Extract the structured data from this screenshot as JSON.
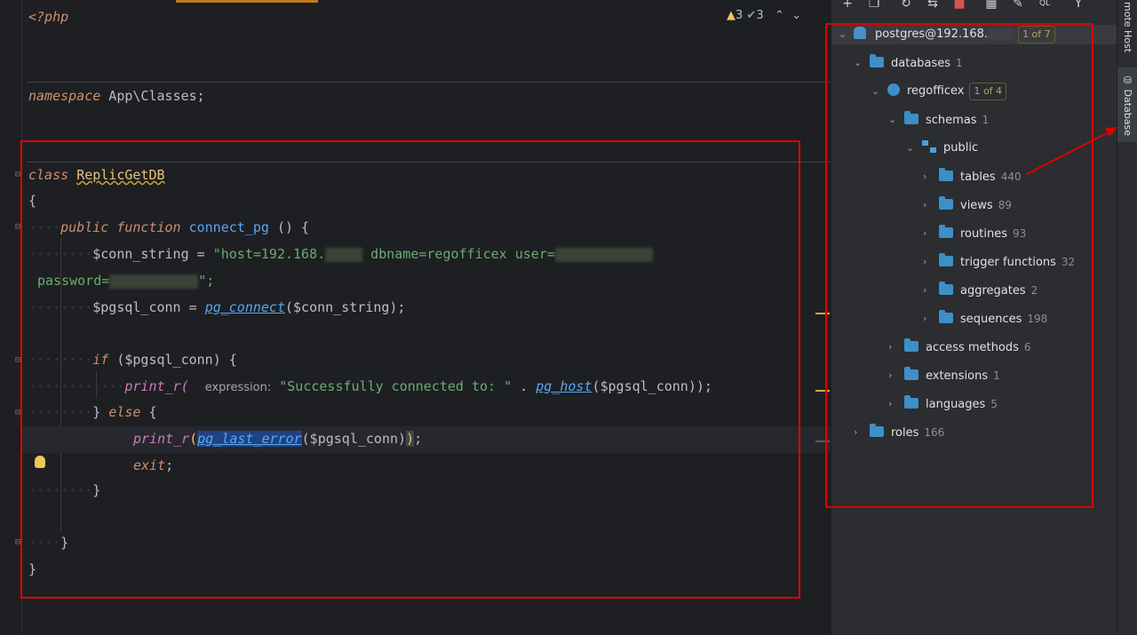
{
  "inspections": {
    "warnings": "3",
    "weak_warnings": "3"
  },
  "code": {
    "php_open": "<?php",
    "namespace_kw": "namespace",
    "namespace_name": " App\\Classes;",
    "class_kw": "class",
    "class_name": "ReplicGetDB",
    "brace_open": "{",
    "public_kw": "public",
    "function_kw": "function",
    "method_name": "connect_pg",
    "method_tail": " () {",
    "conn_var": "$conn_string",
    "assign": " = ",
    "str_part1": "\"host=192.168.",
    "str_part2": " dbname=regofficex user=",
    "str_part3": "password=",
    "str_end": "\";",
    "pgsql_var": "$pgsql_conn",
    "pg_connect": "pg_connect",
    "pg_connect_arg": "($conn_string);",
    "if_kw": "if",
    "if_cond": " ($pgsql_conn) {",
    "print_r": "print_r(",
    "hint_expression": "expression:",
    "success_str": "\"Successfully connected to: \"",
    "dot": " . ",
    "pg_host": "pg_host",
    "pg_host_arg": "($pgsql_conn));",
    "else_open": "} ",
    "else_kw": "else",
    "else_brace": " {",
    "print_r2": "print_r",
    "paren_open": "(",
    "pg_last_error": "pg_last_error",
    "last_err_arg": "($pgsql_conn)",
    "paren_close": ")",
    "semi": ";",
    "exit_kw": "exit",
    "exit_semi": ";",
    "brace_close": "}"
  },
  "toolbar": {
    "add_icon": "plus-icon",
    "refresh_icon": "refresh-icon",
    "stop_icon": "stop-icon",
    "edit_icon": "edit-icon",
    "filter_icon": "filter-icon"
  },
  "tree": {
    "connection": {
      "label": "postgres@192.168.",
      "badge": "1 of 7"
    },
    "databases": {
      "label": "databases",
      "count": "1"
    },
    "regofficex": {
      "label": "regofficex",
      "badge": "1 of 4"
    },
    "schemas": {
      "label": "schemas",
      "count": "1"
    },
    "public": {
      "label": "public"
    },
    "tables": {
      "label": "tables",
      "count": "440"
    },
    "views": {
      "label": "views",
      "count": "89"
    },
    "routines": {
      "label": "routines",
      "count": "93"
    },
    "trigger_functions": {
      "label": "trigger functions",
      "count": "32"
    },
    "aggregates": {
      "label": "aggregates",
      "count": "2"
    },
    "sequences": {
      "label": "sequences",
      "count": "198"
    },
    "access_methods": {
      "label": "access methods",
      "count": "6"
    },
    "extensions": {
      "label": "extensions",
      "count": "1"
    },
    "languages": {
      "label": "languages",
      "count": "5"
    },
    "roles": {
      "label": "roles",
      "count": "166"
    }
  },
  "side_tabs": {
    "remote_host": "mote Host",
    "database": "Database"
  },
  "colors": {
    "annotation_red": "#e00000",
    "folder_blue": "#3d8fc7"
  }
}
